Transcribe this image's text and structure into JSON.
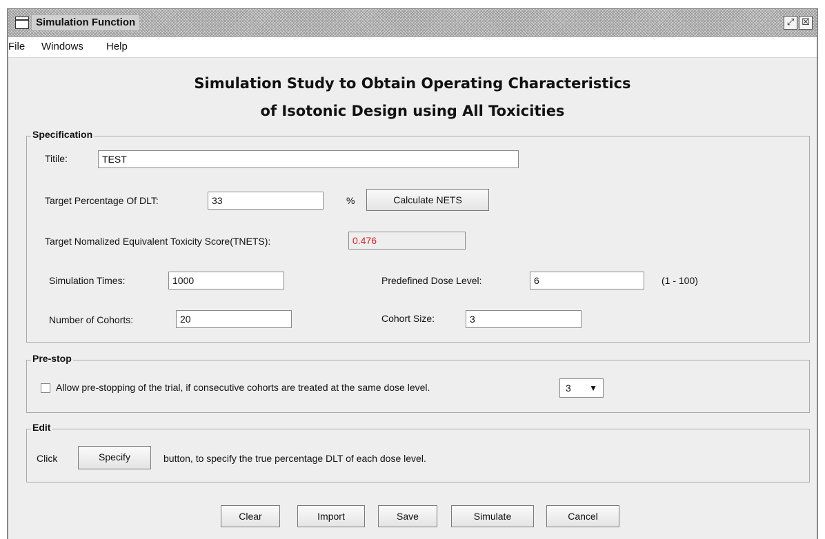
{
  "window": {
    "title": "Simulation Function",
    "restore_icon": "restore-icon",
    "close_icon": "close-icon"
  },
  "menu": [
    "File",
    "Windows",
    "Help"
  ],
  "heading": {
    "line1": "Simulation Study to Obtain Operating Characteristics",
    "line2": "of Isotonic Design using All Toxicities"
  },
  "specification": {
    "legend": "Specification",
    "title_label": "Titile:",
    "title_value": "TEST",
    "target_pct_label": "Target Percentage Of DLT:",
    "target_pct_value": "33",
    "pct_sign": "%",
    "calc_button": "Calculate NETS",
    "tnets_label": "Target Nomalized Equivalent Toxicity Score(TNETS):",
    "tnets_value": "0.476",
    "sim_times_label": "Simulation Times:",
    "sim_times_value": "1000",
    "dose_level_label": "Predefined Dose Level:",
    "dose_level_value": "6",
    "dose_range": "(1 - 100)",
    "cohorts_label": "Number of Cohorts:",
    "cohorts_value": "20",
    "cohort_size_label": "Cohort Size:",
    "cohort_size_value": "3"
  },
  "prestop": {
    "legend": "Pre-stop",
    "checkbox_label": "Allow pre-stopping of the trial, if consecutive cohorts are treated at the same dose level.",
    "checked": false,
    "select_value": "3"
  },
  "edit": {
    "legend": "Edit",
    "click_label": "Click",
    "specify_button": "Specify",
    "after_text": "button, to specify the true percentage DLT of each dose level."
  },
  "footer_buttons": {
    "clear": "Clear",
    "import": "Import",
    "save": "Save",
    "simulate": "Simulate",
    "cancel": "Cancel"
  },
  "colors": {
    "tnets_text": "#e02020",
    "window_bg": "#eeeeee"
  }
}
